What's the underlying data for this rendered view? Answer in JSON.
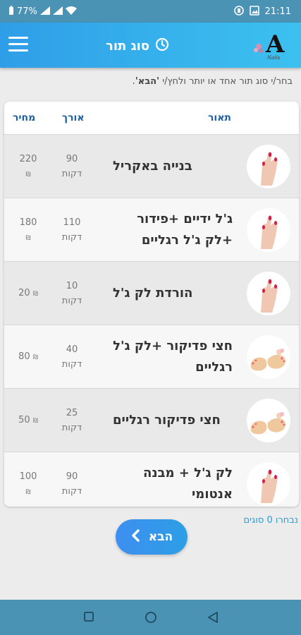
{
  "status_bar": {
    "battery_percent": "77%",
    "time": "21:11"
  },
  "app_bar": {
    "title": "סוג תור",
    "logo_text": "Nails"
  },
  "instruction": {
    "text_before": "בחר/י סוג תור אחד או יותר ולחץ/י ",
    "text_bold": "'הבא'",
    "text_after": "."
  },
  "table": {
    "headers": {
      "description": "תאור",
      "length": "אורך",
      "price": "מחיר"
    },
    "rows": [
      {
        "name": "בנייה באקריל",
        "length_value": "90",
        "length_unit": "דקות",
        "price_value": "220",
        "currency": "₪",
        "thumb": "hand-nails-icon"
      },
      {
        "name": "ג'ל ידיים +פידור +לק ג'ל רגליים",
        "length_value": "110",
        "length_unit": "דקות",
        "price_value": "180",
        "currency": "₪",
        "thumb": "hand-nails-icon"
      },
      {
        "name": "הורדת לק ג'ל",
        "length_value": "10",
        "length_unit": "דקות",
        "price_value": "20",
        "currency": "₪",
        "thumb": "hand-nails-icon"
      },
      {
        "name": "חצי פדיקור +לק ג'ל רגליים",
        "length_value": "40",
        "length_unit": "דקות",
        "price_value": "80",
        "currency": "₪",
        "thumb": "feet-pedicure-icon"
      },
      {
        "name": "חצי פדיקור רגליים",
        "length_value": "25",
        "length_unit": "דקות",
        "price_value": "50",
        "currency": "₪",
        "thumb": "feet-pedicure-icon"
      },
      {
        "name": "לק ג'ל + מבנה אנטומי",
        "length_value": "90",
        "length_unit": "דקות",
        "price_value": "100",
        "currency": "₪",
        "thumb": "hand-nails-icon"
      }
    ]
  },
  "selected_count": "נבחרו 0 סוגים",
  "next_button": {
    "label": "הבא"
  },
  "colors": {
    "app_bar_start": "#2f9ee8",
    "app_bar_end": "#3cc1ef",
    "header_text": "#1d5fa0",
    "accent": "#2d9ad6",
    "status_bar": "#4a93b5"
  }
}
